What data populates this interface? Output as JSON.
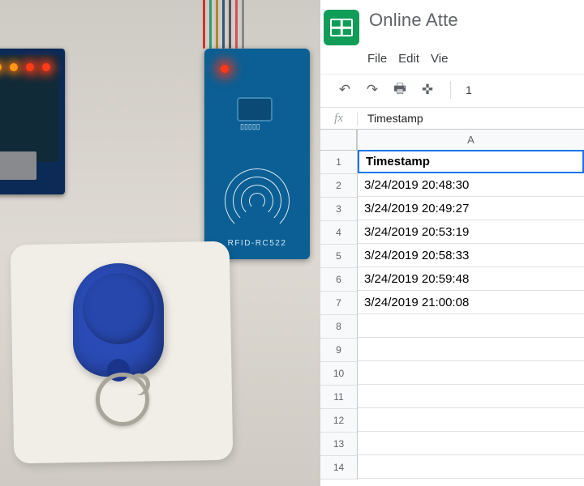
{
  "doc": {
    "title": "Online Atte",
    "menus": {
      "file": "File",
      "edit": "Edit",
      "view": "Vie"
    },
    "toolbar": {
      "zoom": "1"
    }
  },
  "formula_bar": {
    "fx_symbol": "fx",
    "value": "Timestamp"
  },
  "grid": {
    "column_header": "A",
    "rows": [
      {
        "num": "1",
        "value": "Timestamp"
      },
      {
        "num": "2",
        "value": "3/24/2019 20:48:30"
      },
      {
        "num": "3",
        "value": "3/24/2019 20:49:27"
      },
      {
        "num": "4",
        "value": "3/24/2019 20:53:19"
      },
      {
        "num": "5",
        "value": "3/24/2019 20:58:33"
      },
      {
        "num": "6",
        "value": "3/24/2019 20:59:48"
      },
      {
        "num": "7",
        "value": "3/24/2019 21:00:08"
      },
      {
        "num": "8",
        "value": ""
      },
      {
        "num": "9",
        "value": ""
      },
      {
        "num": "10",
        "value": ""
      },
      {
        "num": "11",
        "value": ""
      },
      {
        "num": "12",
        "value": ""
      },
      {
        "num": "13",
        "value": ""
      },
      {
        "num": "14",
        "value": ""
      }
    ]
  },
  "hardware": {
    "rfid_module_label": "RFID-RC522",
    "components": [
      "arduino-board",
      "rfid-reader",
      "rfid-keyfob",
      "rfid-card"
    ],
    "colors": {
      "pcb_blue": "#0b5f94",
      "arduino_blue": "#0b2a56",
      "fob_blue": "#2a4bb5",
      "led_red": "#ff3b18"
    }
  },
  "chart_data": {
    "type": "table",
    "title": "Timestamp",
    "columns": [
      "Timestamp"
    ],
    "rows": [
      [
        "3/24/2019 20:48:30"
      ],
      [
        "3/24/2019 20:49:27"
      ],
      [
        "3/24/2019 20:53:19"
      ],
      [
        "3/24/2019 20:58:33"
      ],
      [
        "3/24/2019 20:59:48"
      ],
      [
        "3/24/2019 21:00:08"
      ]
    ]
  }
}
